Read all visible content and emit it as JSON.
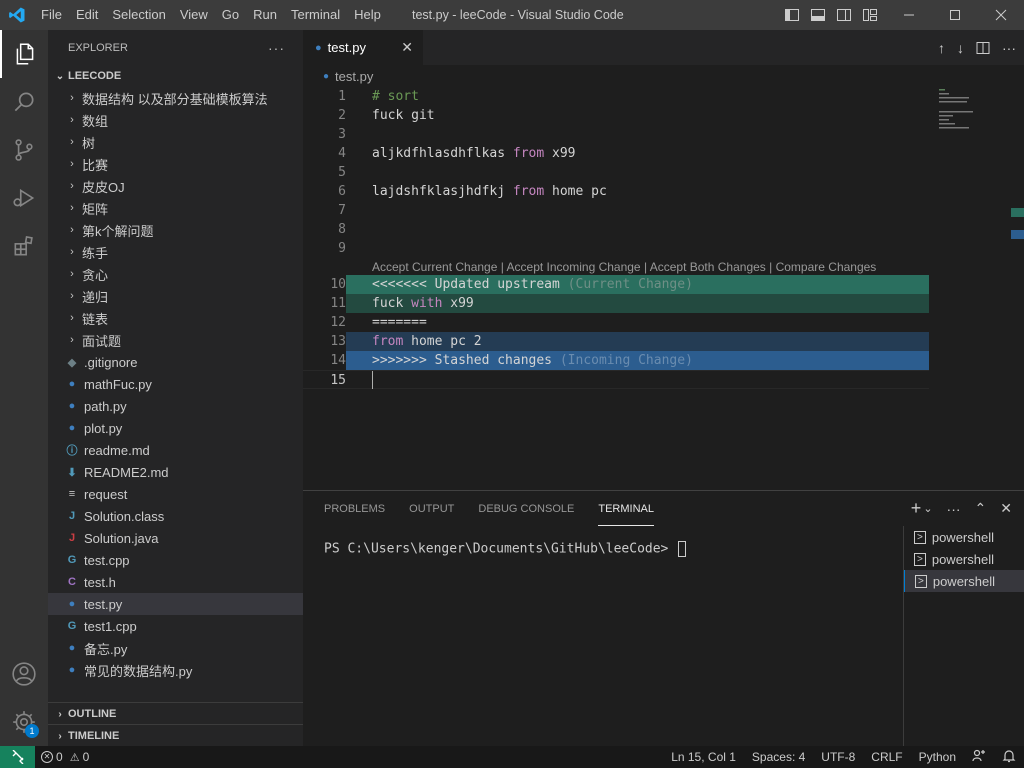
{
  "window": {
    "title": "test.py - leeCode - Visual Studio Code",
    "menu": [
      "File",
      "Edit",
      "Selection",
      "View",
      "Go",
      "Run",
      "Terminal",
      "Help"
    ]
  },
  "activity": {
    "items": [
      "explorer-icon",
      "search-icon",
      "source-control-icon",
      "run-debug-icon",
      "extensions-icon"
    ],
    "accounts": "account-icon",
    "manage": "gear-icon",
    "manage_badge": "1"
  },
  "sidebar": {
    "header": "EXPLORER",
    "more": "···",
    "root": "LEECODE",
    "folders": [
      "数据结构 以及部分基础模板算法",
      "数组",
      "树",
      "比赛",
      "皮皮OJ",
      "矩阵",
      "第k个解问题",
      "练手",
      "贪心",
      "递归",
      "链表",
      "面试题"
    ],
    "files": [
      {
        "name": ".gitignore",
        "icon": "◆",
        "color": "#6d8086"
      },
      {
        "name": "mathFuc.py",
        "icon": "py",
        "color": "#3e7fbf"
      },
      {
        "name": "path.py",
        "icon": "py",
        "color": "#3e7fbf"
      },
      {
        "name": "plot.py",
        "icon": "py",
        "color": "#3e7fbf"
      },
      {
        "name": "readme.md",
        "icon": "ⓘ",
        "color": "#519aba"
      },
      {
        "name": "README2.md",
        "icon": "⬇",
        "color": "#519aba"
      },
      {
        "name": "request",
        "icon": "≡",
        "color": "#c5c5c5"
      },
      {
        "name": "Solution.class",
        "icon": "J",
        "color": "#519aba"
      },
      {
        "name": "Solution.java",
        "icon": "J",
        "color": "#cc3e44"
      },
      {
        "name": "test.cpp",
        "icon": "G",
        "color": "#519aba"
      },
      {
        "name": "test.h",
        "icon": "C",
        "color": "#a074c4"
      },
      {
        "name": "test.py",
        "icon": "py",
        "color": "#3e7fbf"
      },
      {
        "name": "test1.cpp",
        "icon": "G",
        "color": "#519aba"
      },
      {
        "name": "备忘.py",
        "icon": "py",
        "color": "#3e7fbf"
      },
      {
        "name": "常见的数据结构.py",
        "icon": "py",
        "color": "#3e7fbf"
      }
    ],
    "outline": "OUTLINE",
    "timeline": "TIMELINE"
  },
  "editor": {
    "tab": "test.py",
    "breadcrumb": "test.py",
    "lines": {
      "l1": "# sort",
      "l2": "fuck git",
      "l4a": "aljkdfhlasdhflkas ",
      "l4b": "from",
      "l4c": " x99",
      "l6a": "lajdshfklasjhdfkj ",
      "l6b": "from",
      "l6c": " home pc",
      "l10a": "<<<<<<< Updated upstream ",
      "l10b": "(Current Change)",
      "l11a": "fuck ",
      "l11b": "with",
      "l11c": " x99",
      "l12": "=======",
      "l13a": "from",
      "l13b": " home pc 2",
      "l14a": ">>>>>>> Stashed changes ",
      "l14b": "(Incoming Change)"
    },
    "codelens": "Accept Current Change | Accept Incoming Change | Accept Both Changes | Compare Changes",
    "colors": {
      "current_header": "#2a6f5f",
      "current_body": "#234a40",
      "incoming_header": "#2c5d8f",
      "incoming_body": "#243c54"
    }
  },
  "panel": {
    "tabs": [
      "PROBLEMS",
      "OUTPUT",
      "DEBUG CONSOLE",
      "TERMINAL"
    ],
    "active_tab": "TERMINAL",
    "prompt": "PS C:\\Users\\kenger\\Documents\\GitHub\\leeCode> ",
    "terminals": [
      "powershell",
      "powershell",
      "powershell"
    ]
  },
  "status": {
    "errors": "0",
    "warnings": "0",
    "position": "Ln 15, Col 1",
    "spaces": "Spaces: 4",
    "encoding": "UTF-8",
    "eol": "CRLF",
    "language": "Python"
  }
}
